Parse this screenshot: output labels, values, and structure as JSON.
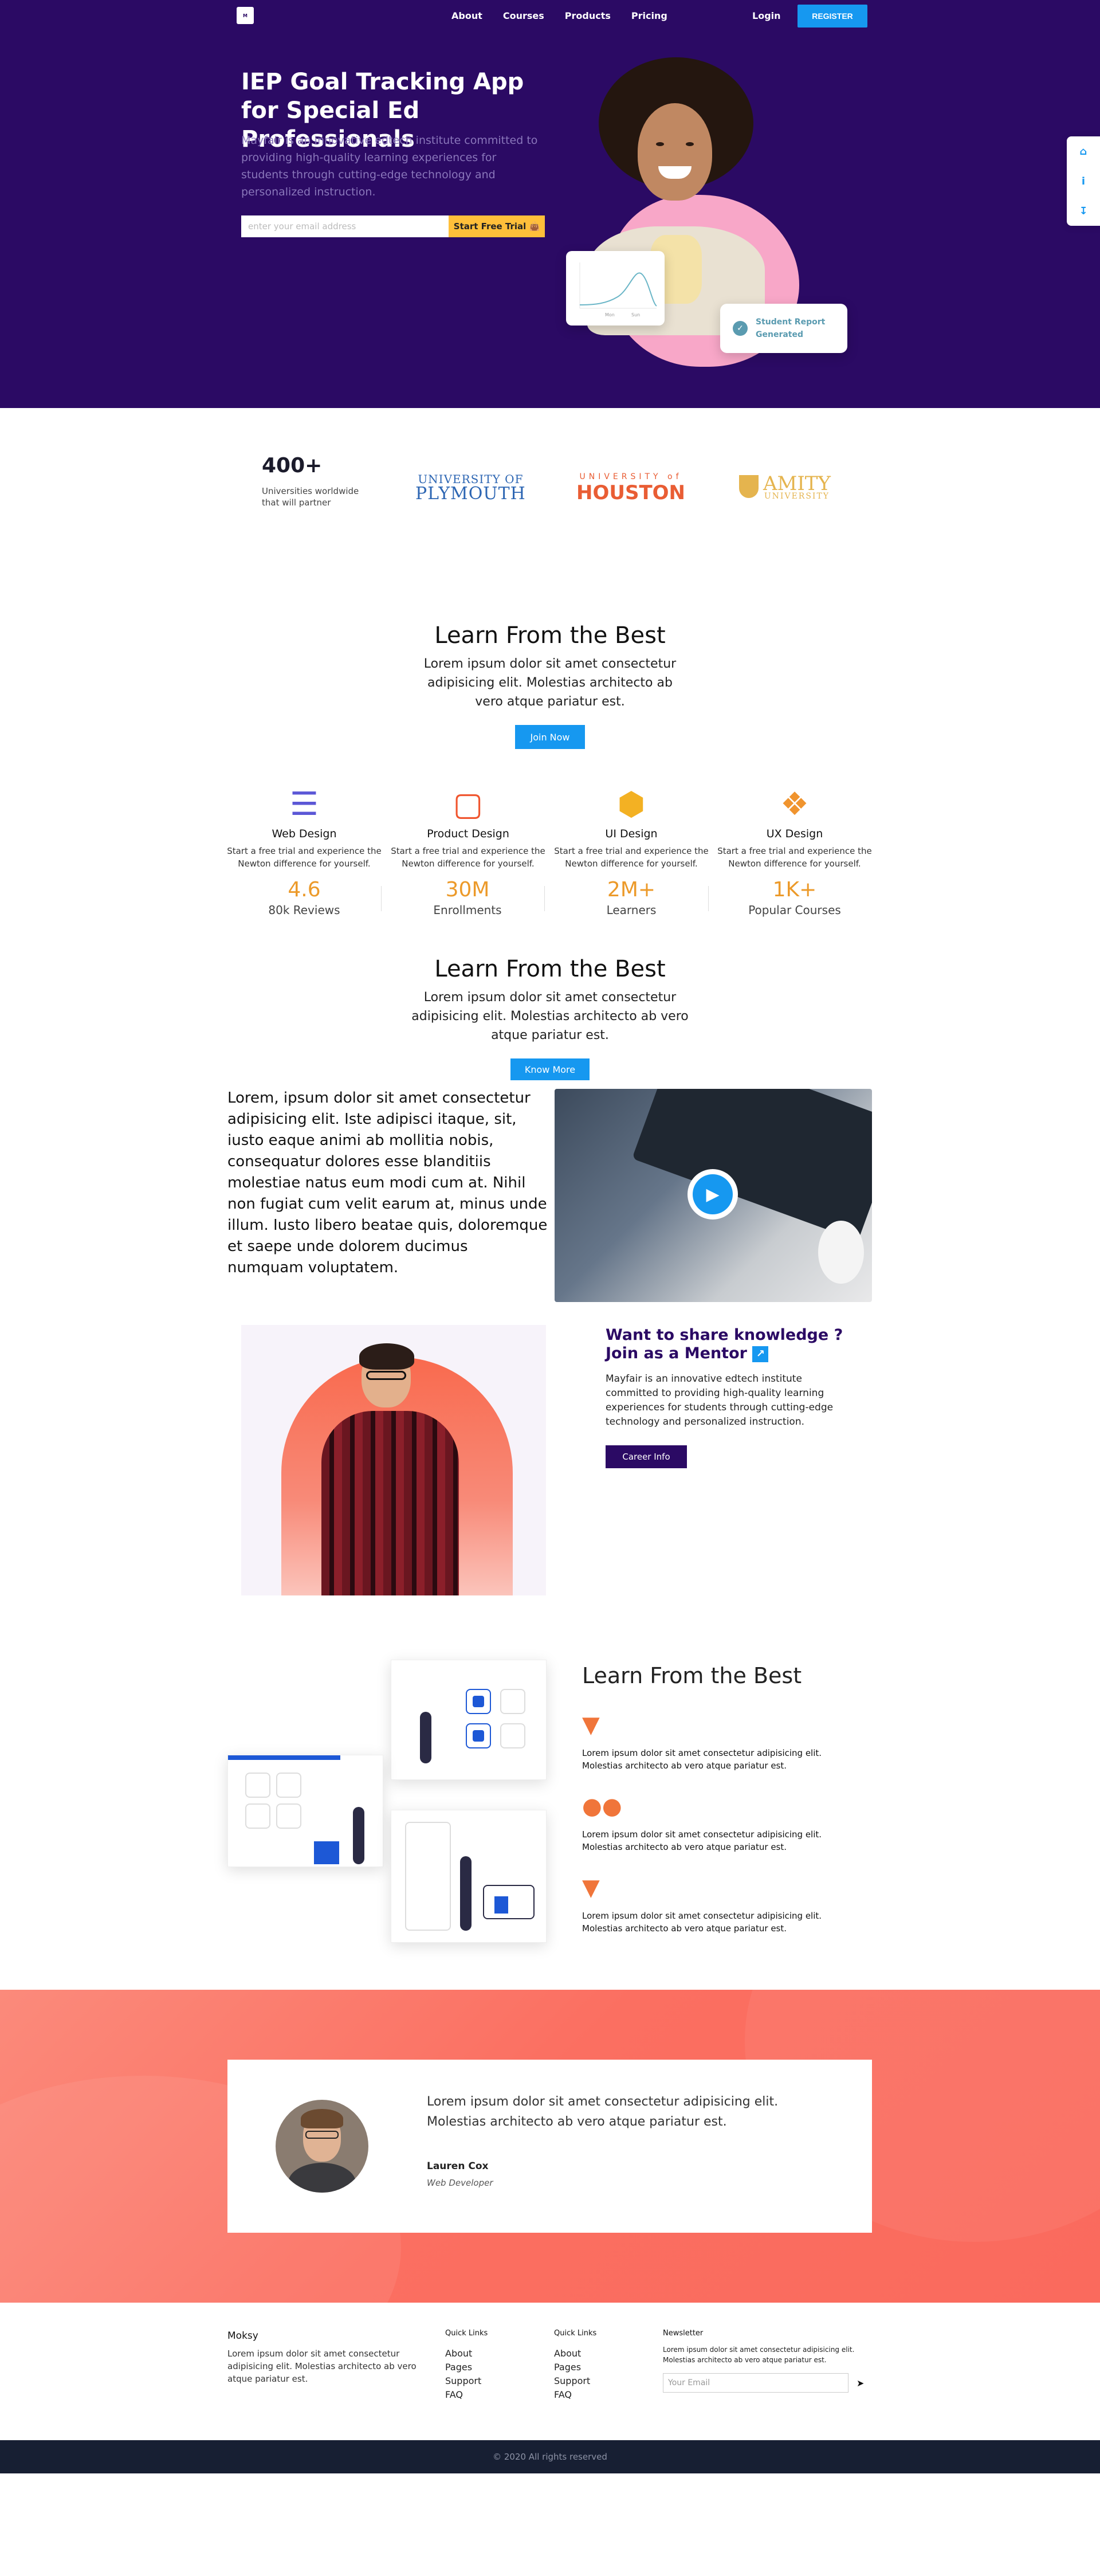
{
  "nav": {
    "links": [
      "About",
      "Courses",
      "Products",
      "Pricing"
    ],
    "login": "Login",
    "register": "REGISTER"
  },
  "hero": {
    "title": "IEP Goal Tracking App for Special Ed Professionals",
    "lead": "Mayfair is an innovative edtech institute committed to providing high-quality learning experiences for students through cutting-edge technology and personalized instruction.",
    "email_placeholder": "enter your email address",
    "cta": "Start Free Trial",
    "report_card": "Student Report Generated",
    "chart_labels": [
      "Mon",
      "Sun"
    ]
  },
  "partners": {
    "count": "400+",
    "count_text": "Universities worldwide that will partner",
    "uni1_top": "UNIVERSITY OF",
    "uni1_bottom": "PLYMOUTH",
    "uni2_top": "UNIVERSITY of",
    "uni2_bottom": "HOUSTON",
    "uni3_top": "AMITY",
    "uni3_bottom": "UNIVERSITY"
  },
  "learn1": {
    "title": "Learn From the Best",
    "text": "Lorem ipsum dolor sit amet consectetur adipisicing elit. Molestias architecto ab vero atque pariatur est.",
    "button": "Join Now"
  },
  "features": [
    {
      "title": "Web Design",
      "text": "Start a free trial and experience the Newton difference for yourself.",
      "icon": "layers-icon",
      "color": "#5b57d6"
    },
    {
      "title": "Product Design",
      "text": "Start a free trial and experience the Newton difference for yourself.",
      "icon": "monitor-icon",
      "color": "#f0552e"
    },
    {
      "title": "UI Design",
      "text": "Start a free trial and experience the Newton difference for yourself.",
      "icon": "box-icon",
      "color": "#f3b123"
    },
    {
      "title": "UX Design",
      "text": "Start a free trial and experience the Newton difference for yourself.",
      "icon": "gift-icon",
      "color": "#f0942e"
    }
  ],
  "stats": [
    {
      "value": "4.6",
      "label": "80k Reviews"
    },
    {
      "value": "30M",
      "label": "Enrollments"
    },
    {
      "value": "2M+",
      "label": "Learners"
    },
    {
      "value": "1K+",
      "label": "Popular Courses"
    }
  ],
  "learn2": {
    "title": "Learn From the Best",
    "text": "Lorem ipsum dolor sit amet consectetur adipisicing elit. Molestias architecto ab vero atque pariatur est.",
    "button": "Know More"
  },
  "video_text": "Lorem, ipsum dolor sit amet consectetur adipisicing elit. Iste adipisci itaque, sit, iusto eaque animi ab mollitia nobis, consequatur dolores esse blanditiis molestiae natus eum modi cum at. Nihil non fugiat cum velit earum at, minus unde illum. Iusto libero beatae quis, doloremque et saepe unde dolorem ducimus numquam voluptatem.",
  "mentor": {
    "title": "Want to share knowledge ? Join as a Mentor",
    "text": "Mayfair is an innovative edtech institute committed to providing high-quality learning experiences for students through cutting-edge technology and personalized instruction.",
    "button": "Career Info"
  },
  "learn3": {
    "title": "Learn From the Best",
    "items": [
      {
        "icon": "funnel-icon",
        "text": "Lorem ipsum dolor sit amet consectetur adipisicing elit. Molestias architecto ab vero atque pariatur est."
      },
      {
        "icon": "people-icon",
        "text": "Lorem ipsum dolor sit amet consectetur adipisicing elit. Molestias architecto ab vero atque pariatur est."
      },
      {
        "icon": "funnel-icon",
        "text": "Lorem ipsum dolor sit amet consectetur adipisicing elit. Molestias architecto ab vero atque pariatur est."
      }
    ]
  },
  "testimonial": {
    "quote": "Lorem ipsum dolor sit amet consectetur adipisicing elit. Molestias architecto ab vero atque pariatur est.",
    "name": "Lauren Cox",
    "role": "Web Developer"
  },
  "footer": {
    "brand": "Moksy",
    "brand_text": "Lorem ipsum dolor sit amet consectetur adipisicing elit. Molestias architecto ab vero atque pariatur est.",
    "col1_title": "Quick Links",
    "col1_links": [
      "About",
      "Pages",
      "Support",
      "FAQ"
    ],
    "col2_title": "Quick Links",
    "col2_links": [
      "About",
      "Pages",
      "Support",
      "FAQ"
    ],
    "news_title": "Newsletter",
    "news_text": "Lorem ipsum dolor sit amet consectetur adipisicing elit. Molestias architecto ab vero atque pariatur est.",
    "email_placeholder": "Your Email",
    "copyright": "© 2020 All rights reserved"
  },
  "colors": {
    "hero_bg": "#2b0a64",
    "accent_blue": "#1698f0",
    "cta_yellow": "#ffbf3a",
    "stat_orange": "#ec9a2a",
    "testimonial_bg": "#fb6f61",
    "footer_bar": "#171f33"
  }
}
